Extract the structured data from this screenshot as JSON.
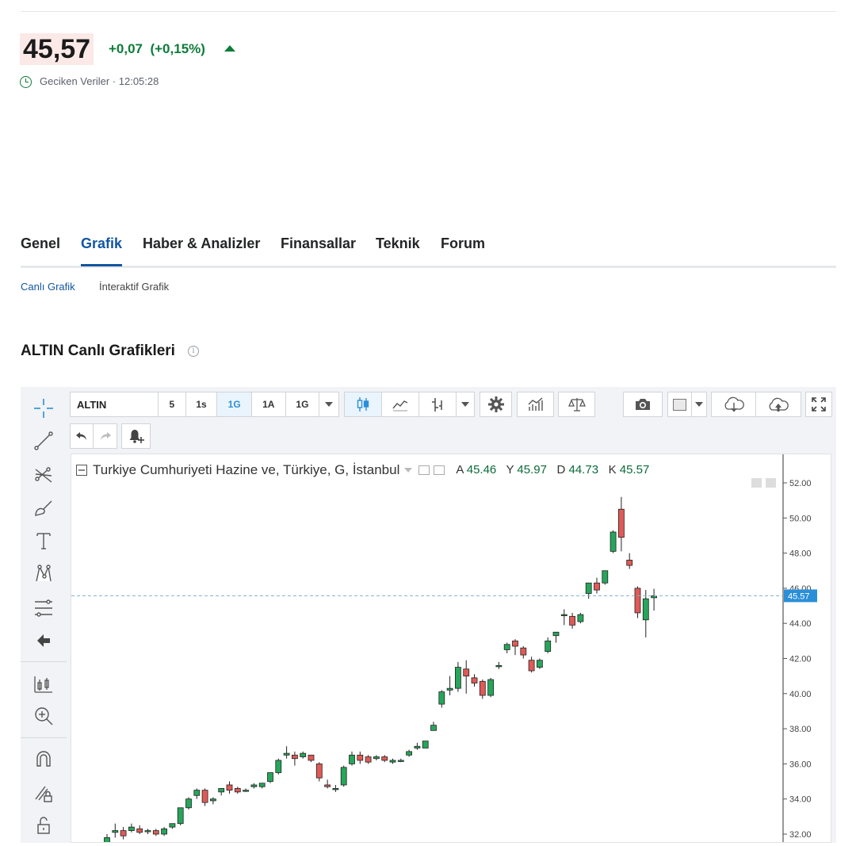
{
  "quote": {
    "price": "45,57",
    "change": "+0,07",
    "change_pct": "(+0,15%)",
    "delay_label": "Geciken Veriler",
    "separator": "·",
    "time": "12:05:28",
    "up_color": "#0e7c3a"
  },
  "tabs": [
    {
      "label": "Genel",
      "active": false
    },
    {
      "label": "Grafik",
      "active": true
    },
    {
      "label": "Haber & Analizler",
      "active": false
    },
    {
      "label": "Finansallar",
      "active": false
    },
    {
      "label": "Teknik",
      "active": false
    },
    {
      "label": "Forum",
      "active": false
    }
  ],
  "subtabs": [
    {
      "label": "Canlı Grafik",
      "active": true
    },
    {
      "label": "İnteraktif Grafik",
      "active": false
    }
  ],
  "section": {
    "title": "ALTIN Canlı Grafikleri",
    "info_icon": "info-icon"
  },
  "toolbar": {
    "symbol": "ALTIN",
    "intervals": [
      "5",
      "1s",
      "1G",
      "1A",
      "1G"
    ],
    "active_interval": "1G",
    "icons": [
      "candles-icon",
      "line-chart-icon",
      "bar-type-icon",
      "settings-icon",
      "indicators-icon",
      "compare-icon",
      "camera-icon",
      "color-swatch-icon",
      "cloud-download-icon",
      "cloud-upload-icon",
      "fullscreen-icon"
    ]
  },
  "left_tools": [
    "crosshair-icon",
    "trendline-icon",
    "pitchfork-icon",
    "brush-icon",
    "text-icon",
    "pattern-icon",
    "fib-retracement-icon",
    "back-arrow-icon",
    "measure-icon",
    "zoom-in-icon",
    "magnet-icon",
    "lock-draw-icon",
    "unlock-icon"
  ],
  "legend": {
    "title": "Turkiye Cumhuriyeti Hazine ve, Türkiye, G, İstanbul",
    "open_label": "A",
    "open": "45.46",
    "high_label": "Y",
    "high": "45.97",
    "low_label": "D",
    "low": "44.73",
    "close_label": "K",
    "close": "45.57"
  },
  "chart_data": {
    "type": "candlestick",
    "y_ticks": [
      "52.00",
      "50.00",
      "48.00",
      "46.00",
      "44.00",
      "42.00",
      "40.00",
      "38.00",
      "36.00",
      "34.00",
      "32.00"
    ],
    "ylim": [
      31.5,
      53.0
    ],
    "last_price_label": "45.57",
    "last_price": 45.57,
    "up_color": "#26a65b",
    "down_color": "#e05a58",
    "candles": [
      {
        "o": 31.3,
        "h": 32.0,
        "l": 31.0,
        "c": 31.8
      },
      {
        "o": 32.1,
        "h": 32.6,
        "l": 31.8,
        "c": 32.2
      },
      {
        "o": 32.2,
        "h": 32.4,
        "l": 31.7,
        "c": 31.9
      },
      {
        "o": 32.2,
        "h": 32.6,
        "l": 32.1,
        "c": 32.4
      },
      {
        "o": 32.3,
        "h": 32.5,
        "l": 32.0,
        "c": 32.1
      },
      {
        "o": 32.2,
        "h": 32.3,
        "l": 32.0,
        "c": 32.2
      },
      {
        "o": 32.2,
        "h": 32.3,
        "l": 31.9,
        "c": 32.0
      },
      {
        "o": 32.0,
        "h": 32.4,
        "l": 31.9,
        "c": 32.3
      },
      {
        "o": 32.4,
        "h": 32.6,
        "l": 32.3,
        "c": 32.6
      },
      {
        "o": 32.6,
        "h": 33.5,
        "l": 32.5,
        "c": 33.5
      },
      {
        "o": 33.5,
        "h": 34.1,
        "l": 33.4,
        "c": 34.0
      },
      {
        "o": 34.2,
        "h": 34.6,
        "l": 34.0,
        "c": 34.5
      },
      {
        "o": 34.5,
        "h": 34.6,
        "l": 33.6,
        "c": 33.8
      },
      {
        "o": 33.9,
        "h": 34.1,
        "l": 33.7,
        "c": 34.0
      },
      {
        "o": 34.4,
        "h": 34.6,
        "l": 34.2,
        "c": 34.6
      },
      {
        "o": 34.8,
        "h": 35.0,
        "l": 34.3,
        "c": 34.5
      },
      {
        "o": 34.6,
        "h": 34.7,
        "l": 34.3,
        "c": 34.4
      },
      {
        "o": 34.5,
        "h": 34.6,
        "l": 34.4,
        "c": 34.5
      },
      {
        "o": 34.7,
        "h": 34.9,
        "l": 34.6,
        "c": 34.8
      },
      {
        "o": 34.7,
        "h": 34.9,
        "l": 34.6,
        "c": 34.9
      },
      {
        "o": 35.0,
        "h": 35.5,
        "l": 34.9,
        "c": 35.5
      },
      {
        "o": 35.5,
        "h": 36.3,
        "l": 35.4,
        "c": 36.2
      },
      {
        "o": 36.5,
        "h": 37.0,
        "l": 36.3,
        "c": 36.6
      },
      {
        "o": 36.5,
        "h": 36.7,
        "l": 35.9,
        "c": 36.3
      },
      {
        "o": 36.4,
        "h": 36.7,
        "l": 36.3,
        "c": 36.6
      },
      {
        "o": 36.5,
        "h": 36.5,
        "l": 36.1,
        "c": 36.2
      },
      {
        "o": 36.0,
        "h": 36.1,
        "l": 35.0,
        "c": 35.2
      },
      {
        "o": 34.8,
        "h": 35.1,
        "l": 34.6,
        "c": 34.7
      },
      {
        "o": 34.6,
        "h": 34.8,
        "l": 34.4,
        "c": 34.6
      },
      {
        "o": 34.8,
        "h": 35.9,
        "l": 34.7,
        "c": 35.8
      },
      {
        "o": 36.0,
        "h": 36.7,
        "l": 35.9,
        "c": 36.5
      },
      {
        "o": 36.5,
        "h": 36.7,
        "l": 36.0,
        "c": 36.2
      },
      {
        "o": 36.4,
        "h": 36.5,
        "l": 36.0,
        "c": 36.1
      },
      {
        "o": 36.3,
        "h": 36.5,
        "l": 36.2,
        "c": 36.4
      },
      {
        "o": 36.4,
        "h": 36.5,
        "l": 36.1,
        "c": 36.2
      },
      {
        "o": 36.1,
        "h": 36.3,
        "l": 36.0,
        "c": 36.2
      },
      {
        "o": 36.2,
        "h": 36.3,
        "l": 36.1,
        "c": 36.2
      },
      {
        "o": 36.5,
        "h": 36.8,
        "l": 36.4,
        "c": 36.7
      },
      {
        "o": 36.9,
        "h": 37.2,
        "l": 36.8,
        "c": 37.0
      },
      {
        "o": 36.9,
        "h": 37.3,
        "l": 36.9,
        "c": 37.3
      },
      {
        "o": 37.9,
        "h": 38.4,
        "l": 37.9,
        "c": 38.2
      },
      {
        "o": 39.4,
        "h": 40.2,
        "l": 39.2,
        "c": 40.1
      },
      {
        "o": 40.2,
        "h": 41.0,
        "l": 39.9,
        "c": 40.3
      },
      {
        "o": 40.3,
        "h": 41.8,
        "l": 40.1,
        "c": 41.5
      },
      {
        "o": 41.4,
        "h": 41.9,
        "l": 40.0,
        "c": 41.0
      },
      {
        "o": 40.9,
        "h": 41.1,
        "l": 40.4,
        "c": 40.6
      },
      {
        "o": 40.7,
        "h": 40.8,
        "l": 39.7,
        "c": 39.9
      },
      {
        "o": 39.9,
        "h": 40.9,
        "l": 39.8,
        "c": 40.8
      },
      {
        "o": 41.6,
        "h": 41.8,
        "l": 41.4,
        "c": 41.6
      },
      {
        "o": 42.5,
        "h": 42.9,
        "l": 42.3,
        "c": 42.8
      },
      {
        "o": 43.0,
        "h": 43.1,
        "l": 42.2,
        "c": 42.7
      },
      {
        "o": 42.6,
        "h": 42.7,
        "l": 42.0,
        "c": 42.2
      },
      {
        "o": 41.9,
        "h": 42.1,
        "l": 41.2,
        "c": 41.3
      },
      {
        "o": 41.5,
        "h": 42.0,
        "l": 41.4,
        "c": 41.9
      },
      {
        "o": 42.4,
        "h": 43.2,
        "l": 42.3,
        "c": 43.0
      },
      {
        "o": 43.3,
        "h": 43.5,
        "l": 42.9,
        "c": 43.5
      },
      {
        "o": 44.5,
        "h": 44.8,
        "l": 43.9,
        "c": 44.5
      },
      {
        "o": 44.4,
        "h": 44.6,
        "l": 43.7,
        "c": 43.9
      },
      {
        "o": 44.1,
        "h": 44.6,
        "l": 44.0,
        "c": 44.5
      },
      {
        "o": 45.7,
        "h": 46.3,
        "l": 45.4,
        "c": 46.3
      },
      {
        "o": 46.3,
        "h": 46.6,
        "l": 45.7,
        "c": 45.9
      },
      {
        "o": 46.3,
        "h": 47.0,
        "l": 46.2,
        "c": 47.0
      },
      {
        "o": 48.1,
        "h": 49.3,
        "l": 48.0,
        "c": 49.2
      },
      {
        "o": 50.5,
        "h": 51.2,
        "l": 48.1,
        "c": 48.9
      },
      {
        "o": 47.6,
        "h": 48.0,
        "l": 47.1,
        "c": 47.3
      },
      {
        "o": 46.0,
        "h": 46.1,
        "l": 44.3,
        "c": 44.6
      },
      {
        "o": 44.2,
        "h": 45.9,
        "l": 43.2,
        "c": 45.4
      },
      {
        "o": 45.46,
        "h": 45.97,
        "l": 44.73,
        "c": 45.57
      }
    ]
  }
}
